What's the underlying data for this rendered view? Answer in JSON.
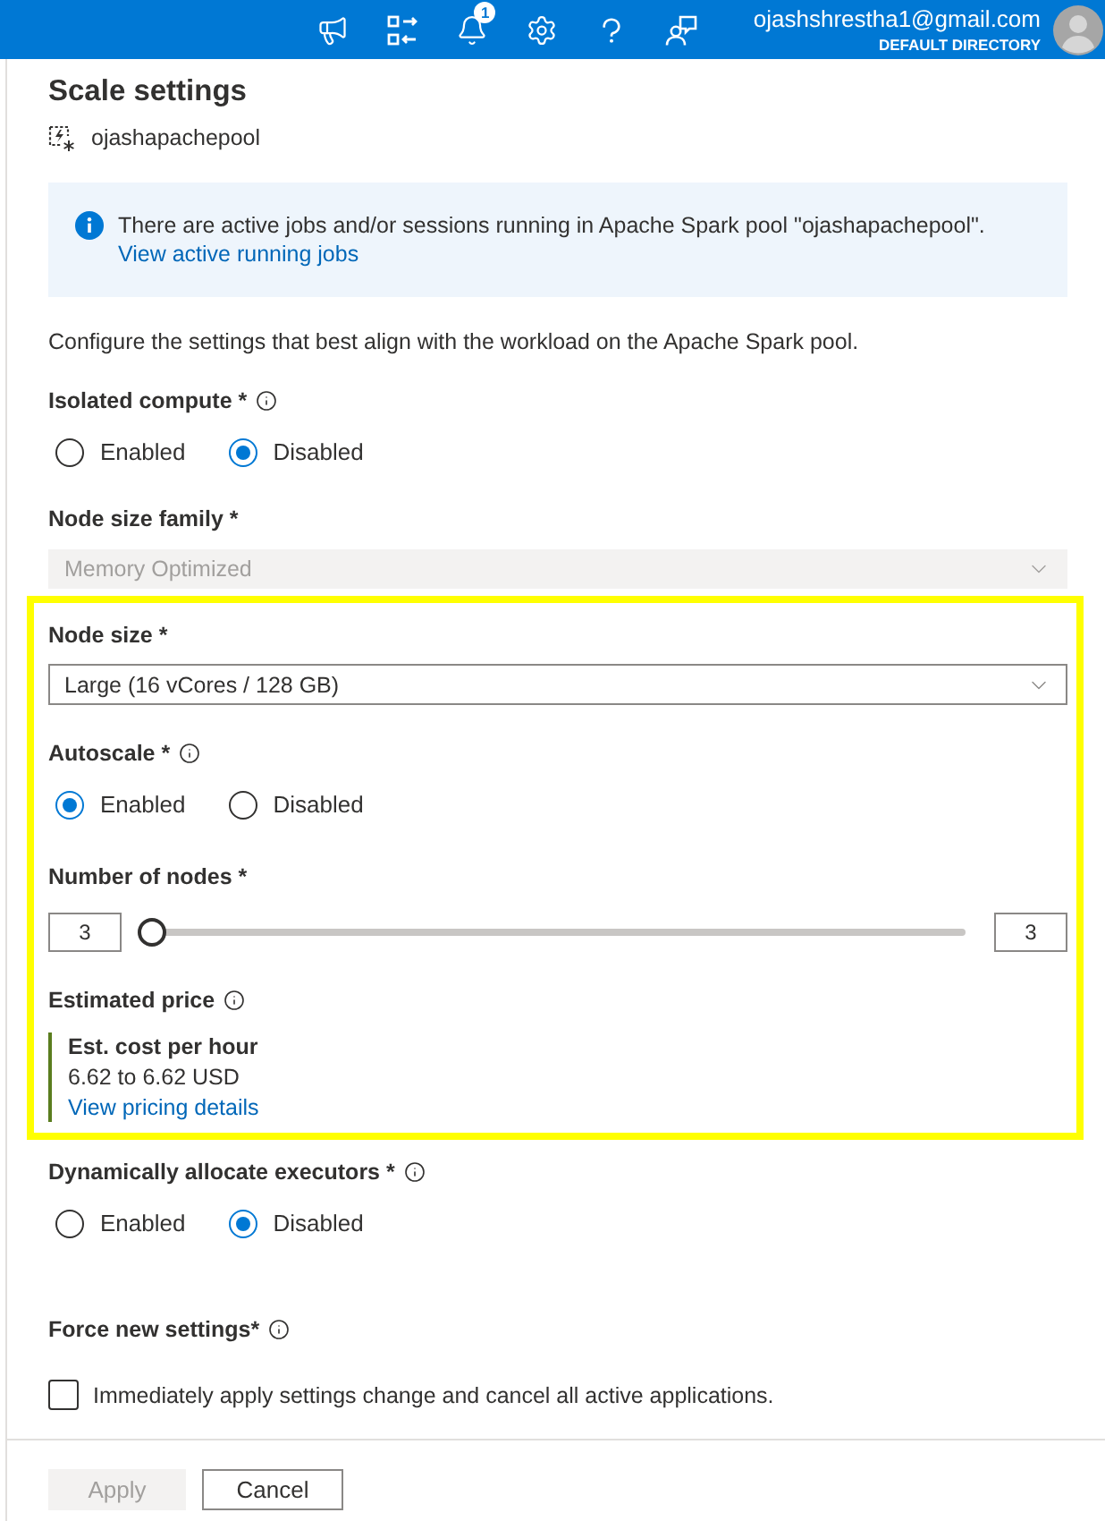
{
  "top_bar": {
    "notification_count": "1",
    "account_email": "ojashshrestha1@gmail.com",
    "account_directory": "DEFAULT DIRECTORY"
  },
  "panel": {
    "title": "Scale settings",
    "resource_name": "ojashapachepool"
  },
  "info_banner": {
    "message": "There are active jobs and/or sessions running in Apache Spark pool \"ojashapachepool\".",
    "link": "View active running jobs"
  },
  "description": "Configure the settings that best align with the workload on the Apache Spark pool.",
  "sections": [
    {
      "highlighted": false,
      "fields": [
        {
          "kind": "radio",
          "label": "Isolated compute *",
          "info_icon": true,
          "options": [
            {
              "label": "Enabled",
              "selected": false
            },
            {
              "label": "Disabled",
              "selected": true
            }
          ]
        },
        {
          "kind": "dropdown",
          "label": "Node size family *",
          "info_icon": false,
          "value": "Memory Optimized",
          "disabled": true
        }
      ]
    },
    {
      "highlighted": true,
      "fields": [
        {
          "kind": "dropdown",
          "label": "Node size *",
          "info_icon": false,
          "value": "Large (16 vCores / 128 GB)",
          "disabled": false
        },
        {
          "kind": "radio",
          "label": "Autoscale *",
          "info_icon": true,
          "options": [
            {
              "label": "Enabled",
              "selected": true
            },
            {
              "label": "Disabled",
              "selected": false
            }
          ]
        },
        {
          "kind": "range",
          "label": "Number of nodes *",
          "info_icon": false,
          "min_value": "3",
          "max_value": "3",
          "level": 0
        },
        {
          "kind": "price",
          "label": "Estimated price",
          "info_icon": true,
          "heading": "Est. cost per hour",
          "amount": "6.62 to 6.62 USD",
          "link": "View pricing details"
        }
      ]
    },
    {
      "highlighted": false,
      "fields": [
        {
          "kind": "radio",
          "label": "Dynamically allocate executors *",
          "info_icon": true,
          "options": [
            {
              "label": "Enabled",
              "selected": false
            },
            {
              "label": "Disabled",
              "selected": true
            }
          ]
        },
        {
          "kind": "checkbox",
          "label": "Force new settings*",
          "info_icon": true,
          "text": "Immediately apply settings change and cancel all active applications.",
          "checked": false
        }
      ]
    }
  ],
  "buttons": [
    {
      "label": "Apply",
      "disabled": true
    },
    {
      "label": "Cancel",
      "disabled": false
    }
  ]
}
